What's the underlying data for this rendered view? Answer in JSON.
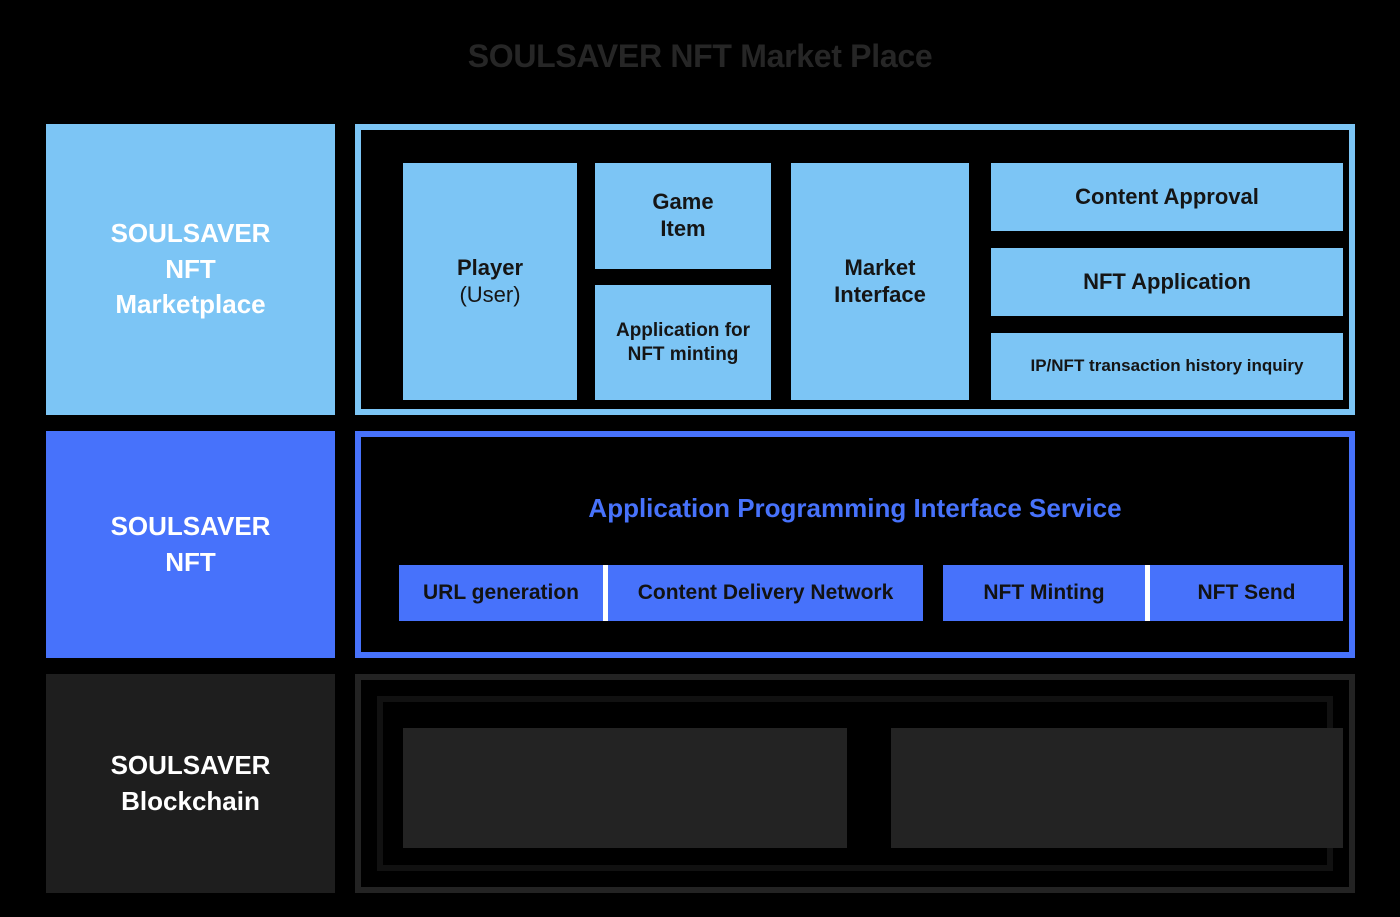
{
  "title": "SOULSAVER NFT Market Place",
  "colors": {
    "background": "#000000",
    "light_blue": "#7CC5F5",
    "royal_blue": "#4772FB",
    "dark_gray": "#1E1E1E",
    "panel_border_dark": "#232323",
    "title_text": "#262626",
    "tile_text": "#151515",
    "label_text": "#FFFFFF"
  },
  "rows": {
    "marketplace": {
      "side_label": "SOULSAVER\nNFT\nMarketplace",
      "side_label_line1": "SOULSAVER",
      "side_label_line2": "NFT",
      "side_label_line3": "Marketplace",
      "tiles": {
        "player_title": "Player",
        "player_sub": "(User)",
        "game_item_line1": "Game",
        "game_item_line2": "Item",
        "app_minting_line1": "Application for",
        "app_minting_line2": "NFT minting",
        "market_interface_line1": "Market",
        "market_interface_line2": "Interface",
        "content_approval": "Content Approval",
        "nft_application": "NFT Application",
        "ip_nft_history": "IP/NFT transaction history inquiry"
      }
    },
    "nft": {
      "side_label_line1": "SOULSAVER",
      "side_label_line2": "NFT",
      "api_heading": "Application Programming Interface Service",
      "api_cells": {
        "url_generation": "URL generation",
        "content_delivery_network": "Content Delivery Network",
        "nft_minting": "NFT Minting",
        "nft_send": "NFT Send"
      }
    },
    "blockchain": {
      "side_label_line1": "SOULSAVER",
      "side_label_line2": "Blockchain",
      "tiles": {
        "left_title": "",
        "left_sub": "",
        "right_title": "",
        "right_sub": ""
      }
    }
  }
}
